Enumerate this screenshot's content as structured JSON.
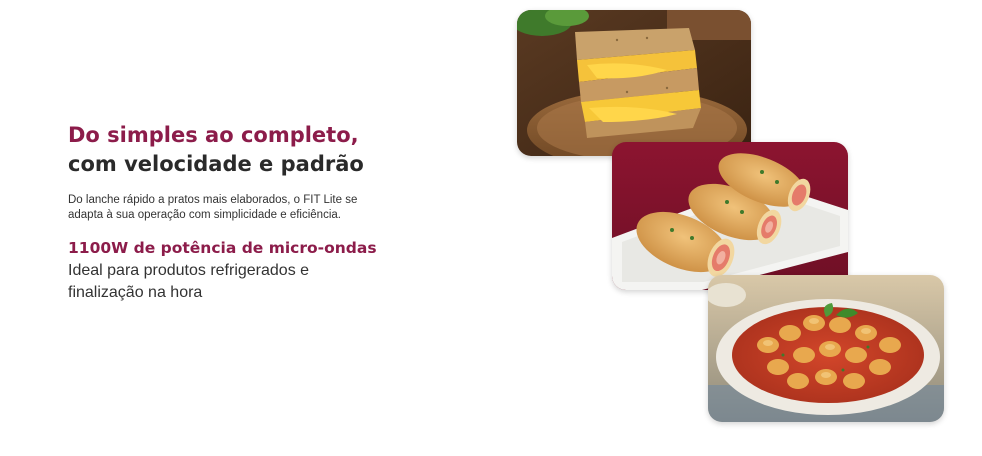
{
  "headline": {
    "line1": "Do simples ao completo,",
    "line2": "com velocidade e padrão"
  },
  "description": "Do lanche rápido a pratos mais elaborados, o FIT Lite se adapta à sua operação com simplicidade e eficiência.",
  "power": {
    "title": "1100W de potência de micro-ondas",
    "description": "Ideal para produtos refrigerados e finalização na hora"
  },
  "colors": {
    "accent": "#8c1c4a",
    "text_dark": "#2a2a2a",
    "background": "#ffffff"
  },
  "images": {
    "top": "grilled-cheese-sandwich-photo",
    "middle": "ham-cheese-rolls-photo",
    "bottom": "gnocchi-tomato-sauce-photo"
  }
}
